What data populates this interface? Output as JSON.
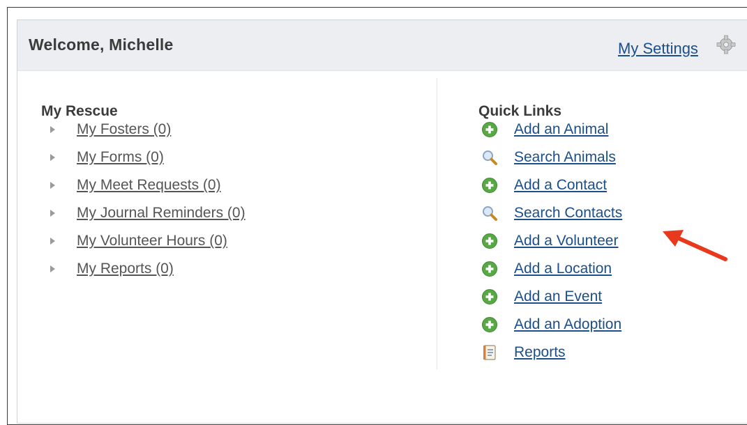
{
  "header": {
    "welcome": "Welcome, Michelle",
    "settings_label": "My Settings",
    "settings_icon": "gear-icon"
  },
  "my_rescue": {
    "title": "My Rescue",
    "items": [
      {
        "label": "My Fosters (0)"
      },
      {
        "label": "My Forms (0)"
      },
      {
        "label": "My Meet Requests (0)"
      },
      {
        "label": "My Journal Reminders (0)"
      },
      {
        "label": "My Volunteer Hours (0)"
      },
      {
        "label": "My Reports (0)"
      }
    ]
  },
  "quick_links": {
    "title": "Quick Links",
    "items": [
      {
        "label": "Add an Animal",
        "icon": "plus-circle-icon"
      },
      {
        "label": "Search Animals",
        "icon": "magnifier-icon"
      },
      {
        "label": "Add a Contact",
        "icon": "plus-circle-icon"
      },
      {
        "label": "Search Contacts",
        "icon": "magnifier-icon"
      },
      {
        "label": "Add a Volunteer",
        "icon": "plus-circle-icon"
      },
      {
        "label": "Add a Location",
        "icon": "plus-circle-icon"
      },
      {
        "label": "Add an Event",
        "icon": "plus-circle-icon"
      },
      {
        "label": "Add an Adoption",
        "icon": "plus-circle-icon"
      },
      {
        "label": "Reports",
        "icon": "report-icon"
      }
    ]
  },
  "colors": {
    "link": "#1a4f8b",
    "header_bg": "#eceef2",
    "plus_green": "#58a845",
    "arrow_red": "#e8391d"
  }
}
